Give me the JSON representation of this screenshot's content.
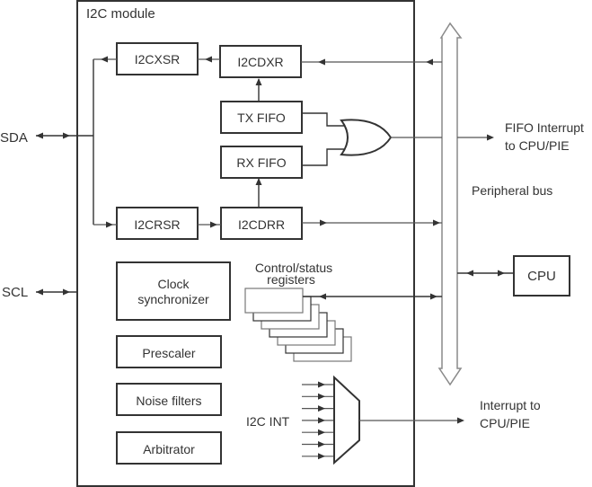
{
  "module": {
    "title": "I2C module"
  },
  "blocks": {
    "i2cxsr": "I2CXSR",
    "i2cdxr": "I2CDXR",
    "tx_fifo": "TX FIFO",
    "rx_fifo": "RX FIFO",
    "i2crsr": "I2CRSR",
    "i2cdrr": "I2CDRR",
    "clock_sync_line1": "Clock",
    "clock_sync_line2": "synchronizer",
    "prescaler": "Prescaler",
    "noise_filters": "Noise filters",
    "arbitrator": "Arbitrator",
    "cpu": "CPU"
  },
  "labels": {
    "sda": "SDA",
    "scl": "SCL",
    "fifo_interrupt_line1": "FIFO Interrupt",
    "fifo_interrupt_line2": "to CPU/PIE",
    "peripheral_bus": "Peripheral bus",
    "control_status_line1": "Control/status",
    "control_status_line2": "registers",
    "i2c_int": "I2C INT",
    "interrupt_line1": "Interrupt to",
    "interrupt_line2": "CPU/PIE"
  },
  "diagram": {
    "register_stack_count": 7,
    "mux_input_count": 7
  }
}
